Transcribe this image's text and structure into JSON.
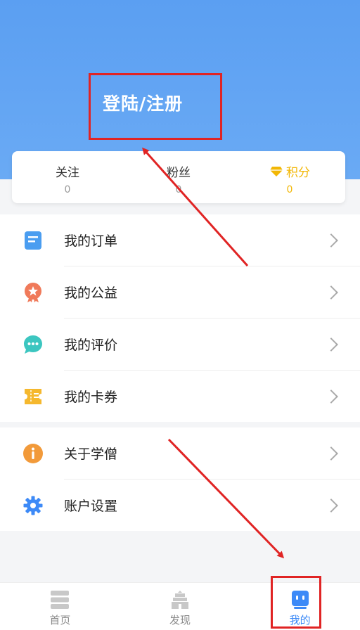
{
  "header": {
    "login_label": "登陆/注册"
  },
  "stats": [
    {
      "label": "关注",
      "value": "0"
    },
    {
      "label": "粉丝",
      "value": "0"
    },
    {
      "label": "积分",
      "value": "0",
      "icon": "diamond-icon",
      "color": "#f2b705"
    }
  ],
  "menu_group1": [
    {
      "label": "我的订单",
      "icon": "order-icon",
      "color": "#4a9df0"
    },
    {
      "label": "我的公益",
      "icon": "charity-badge-icon",
      "color": "#f07a5a"
    },
    {
      "label": "我的评价",
      "icon": "comment-icon",
      "color": "#3cc6c0"
    },
    {
      "label": "我的卡券",
      "icon": "coupon-icon",
      "color": "#f5b82e"
    }
  ],
  "menu_group2": [
    {
      "label": "关于学僧",
      "icon": "info-icon",
      "color": "#f29a3a"
    },
    {
      "label": "账户设置",
      "icon": "gear-icon",
      "color": "#3d8af7"
    }
  ],
  "tabs": [
    {
      "label": "首页",
      "icon": "home-icon",
      "active": false
    },
    {
      "label": "发现",
      "icon": "discover-icon",
      "active": false
    },
    {
      "label": "我的",
      "icon": "profile-icon",
      "active": true
    }
  ],
  "colors": {
    "accent": "#3d8af7",
    "header": "#5b9ff2",
    "annotation": "#e02424"
  }
}
